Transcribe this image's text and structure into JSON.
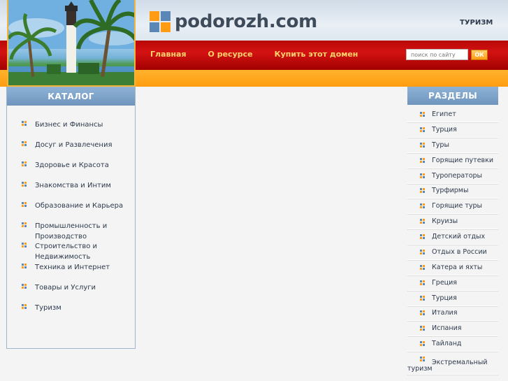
{
  "header": {
    "site_name": "podorozh.com",
    "topic": "ТУРИЗМ",
    "nav": [
      "Главная",
      "О ресурсе",
      "Купить этот домен"
    ],
    "search": {
      "placeholder": "поиск по сайту",
      "button_label": "ОК"
    }
  },
  "catalog": {
    "title": "КАТАЛОГ",
    "items": [
      "Бизнес и Финансы",
      "Досуг и Развлечения",
      "Здоровье и Красота",
      "Знакомства и Интим",
      "Образование и Карьера",
      "Промышленность и Производство",
      "Строительство и Недвижимость",
      "Техника и Интернет",
      "Товары и Услуги",
      "Туризм"
    ]
  },
  "sections": {
    "title": "РАЗДЕЛЫ",
    "items": [
      "Египет",
      "Турция",
      "Туры",
      "Горящие путевки",
      "Туроператоры",
      "Турфирмы",
      "Горящие туры",
      "Круизы",
      "Детский отдых",
      "Отдых в России",
      "Катера и яхты",
      "Греция",
      "Турция",
      "Италия",
      "Испания",
      "Тайланд",
      "Экстремальный туризм"
    ]
  },
  "colors": {
    "accent_red": "#c20c0c",
    "accent_orange": "#ff9c10",
    "box_header": "#7ca2c9"
  },
  "icons": {
    "logo": "logo-squares-icon",
    "bullet": "bullet-squares-icon",
    "photo": "lighthouse-palms-photo"
  }
}
